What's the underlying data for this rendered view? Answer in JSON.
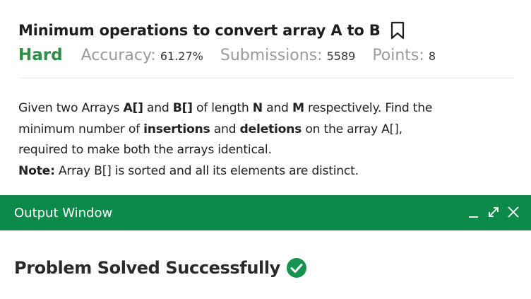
{
  "problem": {
    "title": "Minimum operations to convert array A to B",
    "difficulty": "Hard",
    "accuracy_label": "Accuracy:",
    "accuracy_value": "61.27%",
    "submissions_label": "Submissions:",
    "submissions_value": "5589",
    "points_label": "Points:",
    "points_value": "8"
  },
  "description": {
    "line1": {
      "a": "Given two Arrays ",
      "b": "A[]",
      "c": " and ",
      "d": "B[]",
      "e": " of length ",
      "f": "N",
      "g": " and ",
      "h": "M",
      "i": " respectively. Find the"
    },
    "line2": {
      "a": "minimum number of ",
      "b": "insertions",
      "c": " and ",
      "d": "deletions",
      "e": " on the array A[],"
    },
    "line3": "required to make both the arrays identical.",
    "note_label": "Note:",
    "note_text": " Array B[] is sorted and all its elements are distinct."
  },
  "output_window": {
    "title": "Output Window",
    "controls": [
      "minimize-icon",
      "expand-icon",
      "close-icon"
    ]
  },
  "result": {
    "text": "Problem Solved Successfully",
    "icon": "check-circle-icon"
  },
  "colors": {
    "difficulty": "#2f8d46",
    "output_bar": "#0c8a4a",
    "success_icon": "#16944f"
  }
}
